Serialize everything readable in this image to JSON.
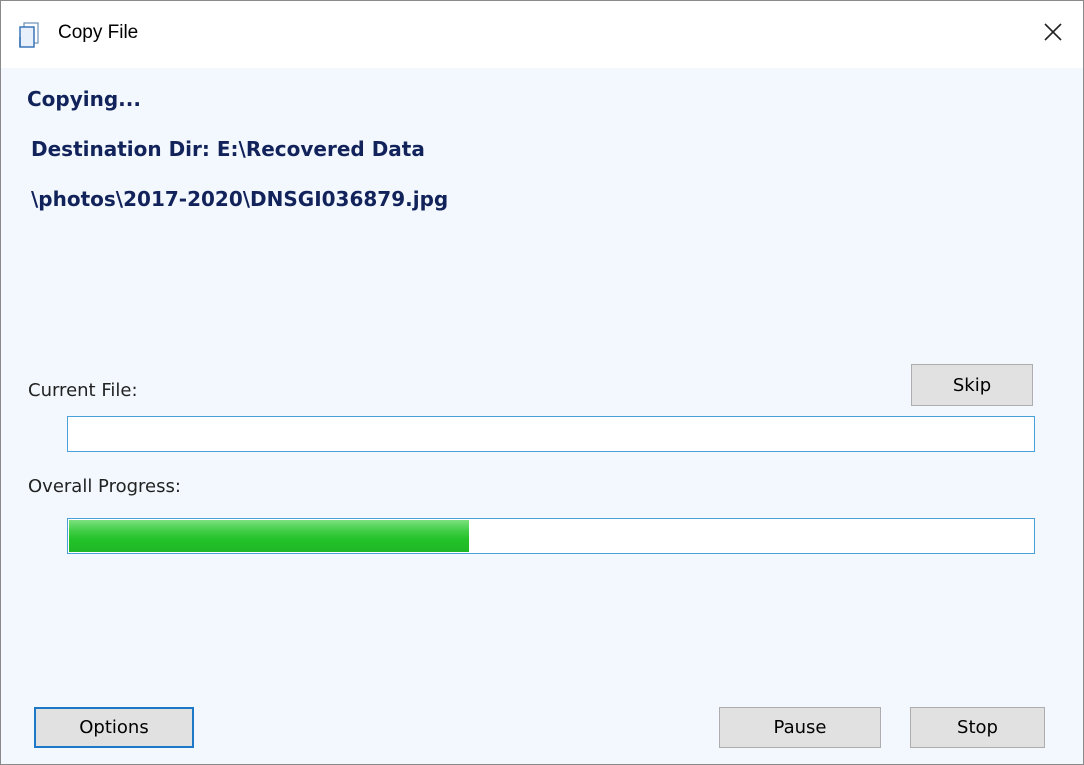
{
  "window": {
    "title": "Copy File"
  },
  "status": {
    "heading": "Copying...",
    "destination": "Destination Dir: E:\\Recovered Data",
    "file_path": "\\photos\\2017-2020\\DNSGI036879.jpg"
  },
  "current_file": {
    "label": "Current File:",
    "progress": 0.0
  },
  "overall": {
    "label": "Overall Progress:",
    "progress": 0.415
  },
  "buttons": {
    "skip": "Skip",
    "options": "Options",
    "pause": "Pause",
    "stop": "Stop"
  },
  "icons": {
    "title": "copy-file-icon",
    "close": "close-icon"
  },
  "colors": {
    "heading_text": "#12225a",
    "progress_fill": "#23c22a",
    "progress_border": "#4aa0d8",
    "focus_border": "#1e78c8",
    "window_bg": "#f2f8fd"
  }
}
